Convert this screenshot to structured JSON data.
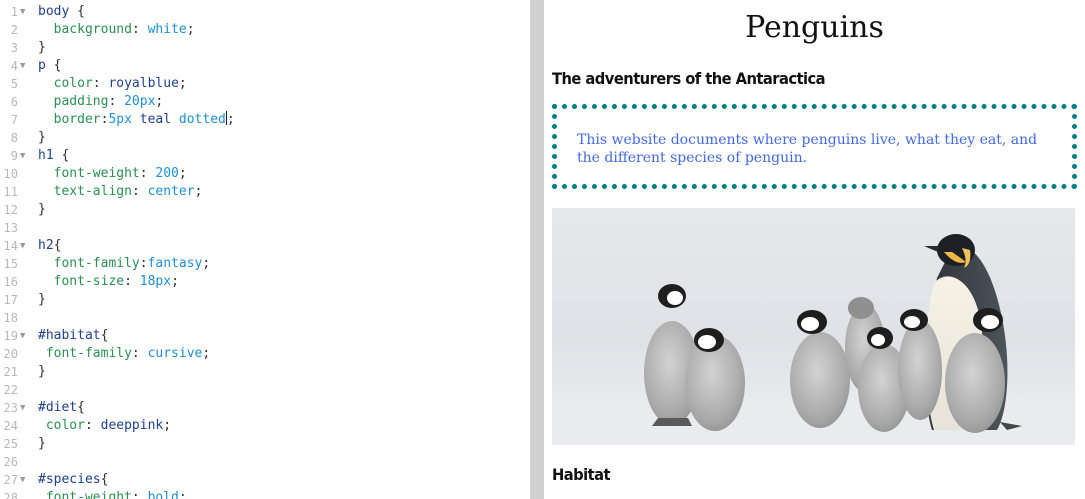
{
  "editor": {
    "lines": [
      {
        "n": "1",
        "fold": true,
        "tokens": [
          [
            "sel",
            "body"
          ],
          [
            "pun",
            " {"
          ]
        ]
      },
      {
        "n": "2",
        "fold": false,
        "tokens": [
          [
            "pun",
            "  "
          ],
          [
            "prop",
            "background"
          ],
          [
            "pun",
            ": "
          ],
          [
            "kw",
            "white"
          ],
          [
            "pun",
            ";"
          ]
        ]
      },
      {
        "n": "3",
        "fold": false,
        "tokens": [
          [
            "pun",
            "}"
          ]
        ]
      },
      {
        "n": "4",
        "fold": true,
        "tokens": [
          [
            "sel",
            "p"
          ],
          [
            "pun",
            " {"
          ]
        ]
      },
      {
        "n": "5",
        "fold": false,
        "tokens": [
          [
            "pun",
            "  "
          ],
          [
            "prop",
            "color"
          ],
          [
            "pun",
            ": "
          ],
          [
            "sel",
            "royalblue"
          ],
          [
            "pun",
            ";"
          ]
        ]
      },
      {
        "n": "6",
        "fold": false,
        "tokens": [
          [
            "pun",
            "  "
          ],
          [
            "prop",
            "padding"
          ],
          [
            "pun",
            ": "
          ],
          [
            "num",
            "20px"
          ],
          [
            "pun",
            ";"
          ]
        ]
      },
      {
        "n": "7",
        "fold": false,
        "cursor_after": 7,
        "tokens": [
          [
            "pun",
            "  "
          ],
          [
            "prop",
            "border"
          ],
          [
            "pun",
            ":"
          ],
          [
            "num",
            "5px"
          ],
          [
            "pun",
            " "
          ],
          [
            "sel",
            "teal"
          ],
          [
            "pun",
            " "
          ],
          [
            "kw",
            "dotted"
          ],
          [
            "pun",
            ";"
          ]
        ]
      },
      {
        "n": "8",
        "fold": false,
        "tokens": [
          [
            "pun",
            "}"
          ]
        ]
      },
      {
        "n": "9",
        "fold": true,
        "tokens": [
          [
            "sel",
            "h1"
          ],
          [
            "pun",
            " {"
          ]
        ]
      },
      {
        "n": "10",
        "fold": false,
        "tokens": [
          [
            "pun",
            "  "
          ],
          [
            "prop",
            "font-weight"
          ],
          [
            "pun",
            ": "
          ],
          [
            "num",
            "200"
          ],
          [
            "pun",
            ";"
          ]
        ]
      },
      {
        "n": "11",
        "fold": false,
        "tokens": [
          [
            "pun",
            "  "
          ],
          [
            "prop",
            "text-align"
          ],
          [
            "pun",
            ": "
          ],
          [
            "kw",
            "center"
          ],
          [
            "pun",
            ";"
          ]
        ]
      },
      {
        "n": "12",
        "fold": false,
        "tokens": [
          [
            "pun",
            "}"
          ]
        ]
      },
      {
        "n": "13",
        "fold": false,
        "tokens": []
      },
      {
        "n": "14",
        "fold": true,
        "tokens": [
          [
            "sel",
            "h2"
          ],
          [
            "pun",
            "{"
          ]
        ]
      },
      {
        "n": "15",
        "fold": false,
        "tokens": [
          [
            "pun",
            "  "
          ],
          [
            "prop",
            "font-family"
          ],
          [
            "pun",
            ":"
          ],
          [
            "kw",
            "fantasy"
          ],
          [
            "pun",
            ";"
          ]
        ]
      },
      {
        "n": "16",
        "fold": false,
        "tokens": [
          [
            "pun",
            "  "
          ],
          [
            "prop",
            "font-size"
          ],
          [
            "pun",
            ": "
          ],
          [
            "num",
            "18px"
          ],
          [
            "pun",
            ";"
          ]
        ]
      },
      {
        "n": "17",
        "fold": false,
        "tokens": [
          [
            "pun",
            "}"
          ]
        ]
      },
      {
        "n": "18",
        "fold": false,
        "tokens": []
      },
      {
        "n": "19",
        "fold": true,
        "tokens": [
          [
            "sel",
            "#habitat"
          ],
          [
            "pun",
            "{"
          ]
        ]
      },
      {
        "n": "20",
        "fold": false,
        "tokens": [
          [
            "pun",
            " "
          ],
          [
            "prop",
            "font-family"
          ],
          [
            "pun",
            ": "
          ],
          [
            "kw",
            "cursive"
          ],
          [
            "pun",
            ";"
          ]
        ]
      },
      {
        "n": "21",
        "fold": false,
        "tokens": [
          [
            "pun",
            "}"
          ]
        ]
      },
      {
        "n": "22",
        "fold": false,
        "tokens": []
      },
      {
        "n": "23",
        "fold": true,
        "tokens": [
          [
            "sel",
            "#diet"
          ],
          [
            "pun",
            "{"
          ]
        ]
      },
      {
        "n": "24",
        "fold": false,
        "tokens": [
          [
            "pun",
            " "
          ],
          [
            "prop",
            "color"
          ],
          [
            "pun",
            ": "
          ],
          [
            "sel",
            "deeppink"
          ],
          [
            "pun",
            ";"
          ]
        ]
      },
      {
        "n": "25",
        "fold": false,
        "tokens": [
          [
            "pun",
            "}"
          ]
        ]
      },
      {
        "n": "26",
        "fold": false,
        "tokens": []
      },
      {
        "n": "27",
        "fold": true,
        "tokens": [
          [
            "sel",
            "#species"
          ],
          [
            "pun",
            "{"
          ]
        ]
      },
      {
        "n": "28",
        "fold": false,
        "tokens": [
          [
            "pun",
            " "
          ],
          [
            "prop",
            "font-weight"
          ],
          [
            "pun",
            ": "
          ],
          [
            "kw",
            "bold"
          ],
          [
            "pun",
            ";"
          ]
        ]
      }
    ]
  },
  "preview": {
    "title": "Penguins",
    "subtitle": "The adventurers of the Antaractica",
    "intro": "This website documents where penguins live, what they eat, and the different species of penguin.",
    "habitat_heading": "Habitat",
    "image_subject": "emperor-penguin-with-chicks"
  },
  "colors": {
    "border": "teal",
    "paragraph": "royalblue",
    "splitter": "#d0d0d0"
  }
}
